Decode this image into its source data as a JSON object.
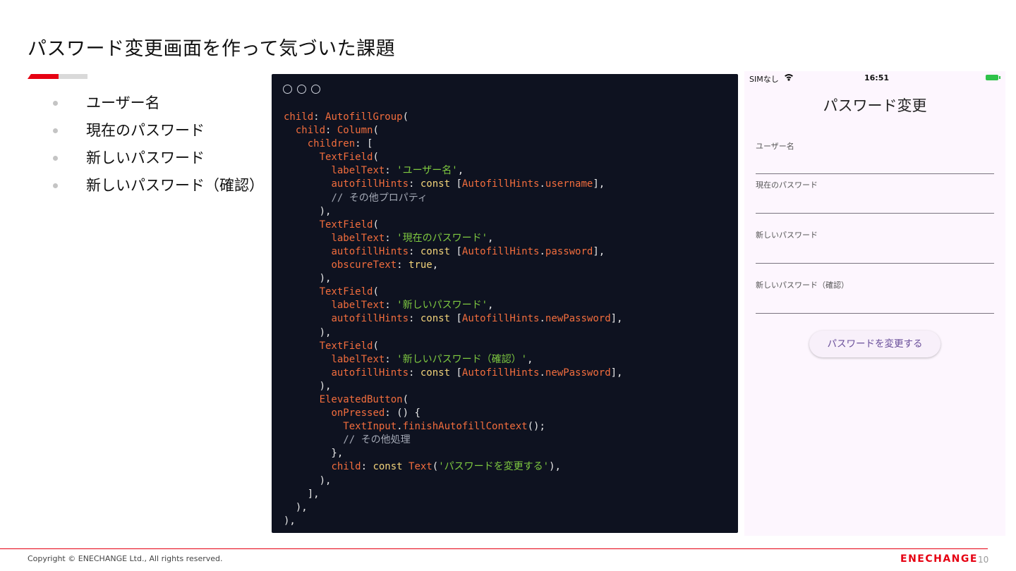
{
  "slide": {
    "title": "パスワード変更画面を作って気づいた課題",
    "bullets": [
      "ユーザー名",
      "現在のパスワード",
      "新しいパスワード",
      "新しいパスワード（確認）"
    ]
  },
  "code": {
    "lines": [
      [
        [
          "p",
          "child"
        ],
        [
          "w",
          ": "
        ],
        [
          "p",
          "AutofillGroup"
        ],
        [
          "w",
          "("
        ]
      ],
      [
        [
          "w",
          "  "
        ],
        [
          "p",
          "child"
        ],
        [
          "w",
          ": "
        ],
        [
          "p",
          "Column"
        ],
        [
          "w",
          "("
        ]
      ],
      [
        [
          "w",
          "    "
        ],
        [
          "p",
          "children"
        ],
        [
          "w",
          ": ["
        ]
      ],
      [
        [
          "w",
          "      "
        ],
        [
          "p",
          "TextField"
        ],
        [
          "w",
          "("
        ]
      ],
      [
        [
          "w",
          "        "
        ],
        [
          "p",
          "labelText"
        ],
        [
          "w",
          ": "
        ],
        [
          "s",
          "'ユーザー名'"
        ],
        [
          "w",
          ","
        ]
      ],
      [
        [
          "w",
          "        "
        ],
        [
          "p",
          "autofillHints"
        ],
        [
          "w",
          ": "
        ],
        [
          "y",
          "const"
        ],
        [
          "w",
          " ["
        ],
        [
          "p",
          "AutofillHints"
        ],
        [
          "w",
          "."
        ],
        [
          "p",
          "username"
        ],
        [
          "w",
          "],"
        ]
      ],
      [
        [
          "w",
          "        "
        ],
        [
          "c",
          "// その他プロパティ"
        ]
      ],
      [
        [
          "w",
          "      ),"
        ]
      ],
      [
        [
          "w",
          "      "
        ],
        [
          "p",
          "TextField"
        ],
        [
          "w",
          "("
        ]
      ],
      [
        [
          "w",
          "        "
        ],
        [
          "p",
          "labelText"
        ],
        [
          "w",
          ": "
        ],
        [
          "s",
          "'現在のパスワード'"
        ],
        [
          "w",
          ","
        ]
      ],
      [
        [
          "w",
          "        "
        ],
        [
          "p",
          "autofillHints"
        ],
        [
          "w",
          ": "
        ],
        [
          "y",
          "const"
        ],
        [
          "w",
          " ["
        ],
        [
          "p",
          "AutofillHints"
        ],
        [
          "w",
          "."
        ],
        [
          "p",
          "password"
        ],
        [
          "w",
          "],"
        ]
      ],
      [
        [
          "w",
          "        "
        ],
        [
          "p",
          "obscureText"
        ],
        [
          "w",
          ": "
        ],
        [
          "y",
          "true"
        ],
        [
          "w",
          ","
        ]
      ],
      [
        [
          "w",
          "      ),"
        ]
      ],
      [
        [
          "w",
          "      "
        ],
        [
          "p",
          "TextField"
        ],
        [
          "w",
          "("
        ]
      ],
      [
        [
          "w",
          "        "
        ],
        [
          "p",
          "labelText"
        ],
        [
          "w",
          ": "
        ],
        [
          "s",
          "'新しいパスワード'"
        ],
        [
          "w",
          ","
        ]
      ],
      [
        [
          "w",
          "        "
        ],
        [
          "p",
          "autofillHints"
        ],
        [
          "w",
          ": "
        ],
        [
          "y",
          "const"
        ],
        [
          "w",
          " ["
        ],
        [
          "p",
          "AutofillHints"
        ],
        [
          "w",
          "."
        ],
        [
          "p",
          "newPassword"
        ],
        [
          "w",
          "],"
        ]
      ],
      [
        [
          "w",
          "      ),"
        ]
      ],
      [
        [
          "w",
          "      "
        ],
        [
          "p",
          "TextField"
        ],
        [
          "w",
          "("
        ]
      ],
      [
        [
          "w",
          "        "
        ],
        [
          "p",
          "labelText"
        ],
        [
          "w",
          ": "
        ],
        [
          "s",
          "'新しいパスワード（確認）'"
        ],
        [
          "w",
          ","
        ]
      ],
      [
        [
          "w",
          "        "
        ],
        [
          "p",
          "autofillHints"
        ],
        [
          "w",
          ": "
        ],
        [
          "y",
          "const"
        ],
        [
          "w",
          " ["
        ],
        [
          "p",
          "AutofillHints"
        ],
        [
          "w",
          "."
        ],
        [
          "p",
          "newPassword"
        ],
        [
          "w",
          "],"
        ]
      ],
      [
        [
          "w",
          "      ),"
        ]
      ],
      [
        [
          "w",
          "      "
        ],
        [
          "p",
          "ElevatedButton"
        ],
        [
          "w",
          "("
        ]
      ],
      [
        [
          "w",
          "        "
        ],
        [
          "p",
          "onPressed"
        ],
        [
          "w",
          ": () {"
        ]
      ],
      [
        [
          "w",
          "          "
        ],
        [
          "p",
          "TextInput"
        ],
        [
          "w",
          "."
        ],
        [
          "p",
          "finishAutofillContext"
        ],
        [
          "w",
          "();"
        ]
      ],
      [
        [
          "w",
          "          "
        ],
        [
          "c",
          "// その他処理"
        ]
      ],
      [
        [
          "w",
          "        },"
        ]
      ],
      [
        [
          "w",
          "        "
        ],
        [
          "p",
          "child"
        ],
        [
          "w",
          ": "
        ],
        [
          "y",
          "const"
        ],
        [
          "w",
          " "
        ],
        [
          "p",
          "Text"
        ],
        [
          "w",
          "("
        ],
        [
          "s",
          "'パスワードを変更する'"
        ],
        [
          "w",
          "),"
        ]
      ],
      [
        [
          "w",
          "      ),"
        ]
      ],
      [
        [
          "w",
          "    ],"
        ]
      ],
      [
        [
          "w",
          "  ),"
        ]
      ],
      [
        [
          "w",
          "),"
        ]
      ]
    ]
  },
  "phone": {
    "status": {
      "carrier": "SIMなし",
      "time": "16:51"
    },
    "title": "パスワード変更",
    "fields": [
      {
        "label": "ユーザー名",
        "value": ""
      },
      {
        "label": "現在のパスワード",
        "value": ""
      },
      {
        "label": "新しいパスワード",
        "value": ""
      },
      {
        "label": "新しいパスワード（確認）",
        "value": ""
      }
    ],
    "submit_label": "パスワードを変更する"
  },
  "footer": {
    "copyright": "Copyright © ENECHANGE Ltd., All rights reserved.",
    "logo": "ENECHANGE",
    "page_number": "10"
  },
  "colors": {
    "accent_red": "#e60012",
    "code_background": "#0e1220",
    "code_identifier": "#f26d3d",
    "code_keyword": "#f2d37a",
    "code_string": "#7ec940",
    "phone_background": "#fdf6fe"
  }
}
